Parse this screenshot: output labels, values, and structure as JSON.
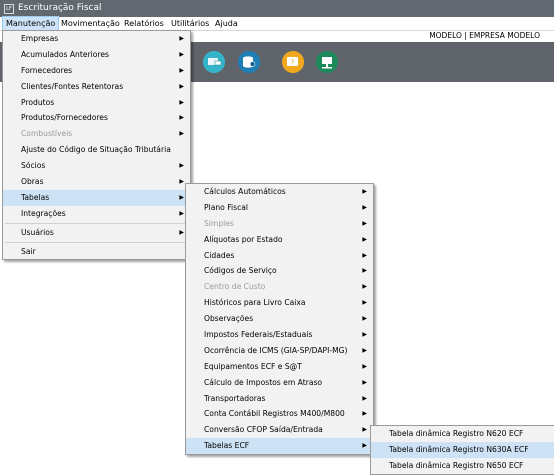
{
  "window": {
    "title": "Escrituração Fiscal",
    "icon_text": "LF"
  },
  "menubar": {
    "items": [
      "Manutenção",
      "Movimentação",
      "Relatórios",
      "Utilitários",
      "Ajuda"
    ]
  },
  "company_label": "MODELO | EMPRESA MODELO",
  "toolbar": {
    "icons": [
      "tool-icon-1",
      "tool-icon-2",
      "tool-icon-3",
      "tool-icon-4",
      "tool-icon-5"
    ]
  },
  "menu_manutencao": {
    "items": [
      {
        "label": "Empresas",
        "submenu": true
      },
      {
        "label": "Acumulados Anteriores",
        "submenu": true
      },
      {
        "label": "Fornecedores",
        "submenu": true
      },
      {
        "label": "Clientes/Fontes Retentoras",
        "submenu": true
      },
      {
        "label": "Produtos",
        "submenu": true
      },
      {
        "label": "Produtos/Fornecedores",
        "submenu": true
      },
      {
        "label": "Combustíveis",
        "submenu": true,
        "disabled": true
      },
      {
        "label": "Ajuste do Código de Situação Tributária",
        "submenu": false
      },
      {
        "label": "Sócios",
        "submenu": true
      },
      {
        "label": "Obras",
        "submenu": true
      },
      {
        "label": "Tabelas",
        "submenu": true,
        "highlight": true
      },
      {
        "label": "Integrações",
        "submenu": true
      },
      {
        "label": "Usuários",
        "submenu": true
      },
      {
        "label": "Sair",
        "submenu": false
      }
    ]
  },
  "menu_tabelas": {
    "items": [
      {
        "label": "Cálculos Automáticos",
        "submenu": true
      },
      {
        "label": "Plano Fiscal",
        "submenu": true
      },
      {
        "label": "Simples",
        "submenu": true,
        "disabled": true
      },
      {
        "label": "Alíquotas por Estado",
        "submenu": true
      },
      {
        "label": "Cidades",
        "submenu": true
      },
      {
        "label": "Códigos de Serviço",
        "submenu": true
      },
      {
        "label": "Centro de Custo",
        "submenu": true,
        "disabled": true
      },
      {
        "label": "Históricos para Livro Caixa",
        "submenu": true
      },
      {
        "label": "Observações",
        "submenu": true
      },
      {
        "label": "Impostos Federais/Estaduais",
        "submenu": true
      },
      {
        "label": "Ocorrência de ICMS (GIA-SP/DAPI-MG)",
        "submenu": true
      },
      {
        "label": "Equipamentos ECF e S@T",
        "submenu": true
      },
      {
        "label": "Cálculo de Impostos em Atraso",
        "submenu": true
      },
      {
        "label": "Transportadoras",
        "submenu": true
      },
      {
        "label": "Conta Contábil Registros M400/M800",
        "submenu": true
      },
      {
        "label": "Conversão CFOP Saída/Entrada",
        "submenu": true
      },
      {
        "label": "Tabelas ECF",
        "submenu": true,
        "highlight": true
      }
    ]
  },
  "menu_tabelas_ecf": {
    "items": [
      {
        "label": "Tabela dinâmica Registro N620 ECF"
      },
      {
        "label": "Tabela dinâmica Registro N630A ECF",
        "highlight": true
      },
      {
        "label": "Tabela dinâmica Registro N650 ECF"
      }
    ]
  },
  "colors": {
    "titlebar": "#626870",
    "toolbar": "#5f646b",
    "menu_bg": "#f2f2f2",
    "highlight": "#cde3f5"
  }
}
